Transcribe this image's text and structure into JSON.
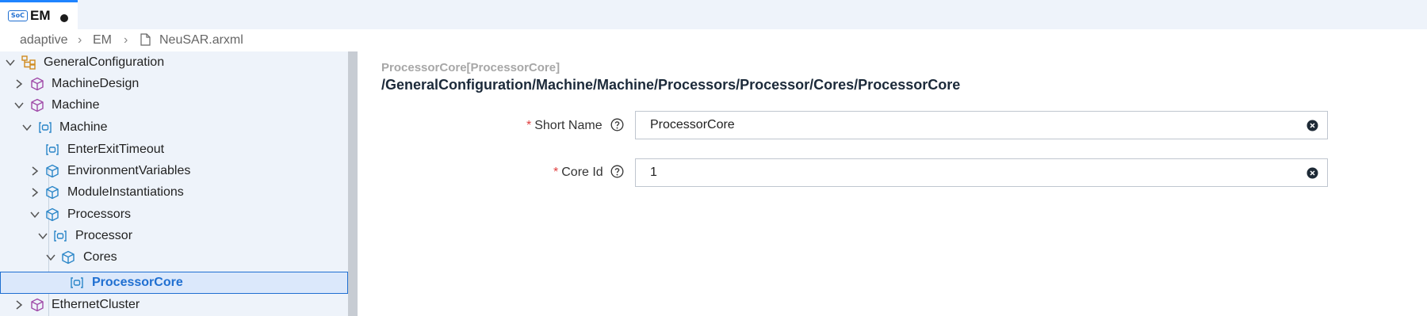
{
  "tab": {
    "badge": "SoC",
    "title": "EM"
  },
  "breadcrumb": {
    "items": [
      "adaptive",
      "EM",
      "NeuSAR.arxml"
    ]
  },
  "tree": {
    "general": "GeneralConfiguration",
    "machine_design": "MachineDesign",
    "machine": "Machine",
    "machine_child": "Machine",
    "enter_exit_timeout": "EnterExitTimeout",
    "environment_variables": "EnvironmentVariables",
    "module_instantiations": "ModuleInstantiations",
    "processors": "Processors",
    "processor": "Processor",
    "cores": "Cores",
    "processor_core": "ProcessorCore",
    "ethernet_cluster": "EthernetCluster"
  },
  "detail": {
    "type_label": "ProcessorCore[ProcessorCore]",
    "path": "/GeneralConfiguration/Machine/Machine/Processors/Processor/Cores/ProcessorCore",
    "short_name": {
      "label": "Short Name",
      "value": "ProcessorCore"
    },
    "core_id": {
      "label": "Core Id",
      "value": "1"
    },
    "required_mark": "*"
  },
  "colors": {
    "accent": "#1f6fd1",
    "sidebar_bg": "#eef3fa",
    "required": "#e04040"
  }
}
